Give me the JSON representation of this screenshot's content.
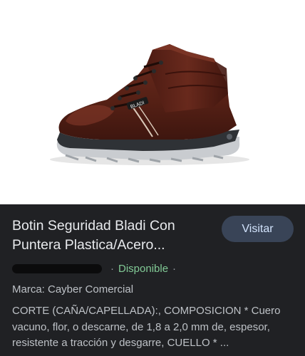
{
  "product": {
    "title": "Botin Seguridad Bladi Con Puntera Plastica/Acero...",
    "visit_label": "Visitar",
    "availability": "Disponible",
    "separator": "·",
    "brand_line": "Marca: Cayber Comercial",
    "description": "CORTE (CAÑA/CAPELLADA):, COMPOSICION * Cuero vacuno, flor, o descarne, de 1,8 a 2,0 mm de, espesor, resistente a tracción y desgarre, CUELLO * ...",
    "image_label": "BLADI"
  },
  "colors": {
    "background": "#202124",
    "button_bg": "#394457",
    "button_text": "#d2e3fc",
    "availability": "#81c995",
    "boot_leather": "#5a2418"
  }
}
